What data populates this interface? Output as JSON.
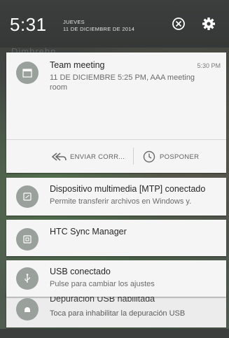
{
  "header": {
    "time": "5:31",
    "day": "JUEVES",
    "date": "11 DE DICIEMBRE DE 2014",
    "clear_icon": "close-circle-icon",
    "settings_icon": "gear-icon"
  },
  "background_text": "Dimhrebn",
  "notifications": [
    {
      "title": "Team meeting",
      "time": "5:30 PM",
      "line1": "11 DE DICIEMBRE 5:25 PM, AAA meeting",
      "line2": "room",
      "icon": "calendar-icon",
      "actions": [
        {
          "label": "ENVIAR CORR...",
          "icon": "reply-all-icon"
        },
        {
          "label": "POSPONER",
          "icon": "clock-icon"
        }
      ]
    },
    {
      "title": "Dispositivo multimedia [MTP] conectado",
      "subtitle": "Permite transferir archivos en Windows y.",
      "icon": "usb-storage-icon"
    },
    {
      "title": "HTC Sync Manager",
      "icon": "sync-manager-icon"
    },
    {
      "title": "USB conectado",
      "subtitle": "Pulse para cambiar los ajustes",
      "icon": "usb-icon"
    },
    {
      "title": "Depuración USB habilitada",
      "subtitle": "Toca para inhabilitar la depuración USB",
      "icon": "android-debug-icon"
    }
  ],
  "colors": {
    "header_bg": "#3b3e3c",
    "card_bg": "#f5f5f5",
    "avatar_bg": "#9aa09c"
  }
}
